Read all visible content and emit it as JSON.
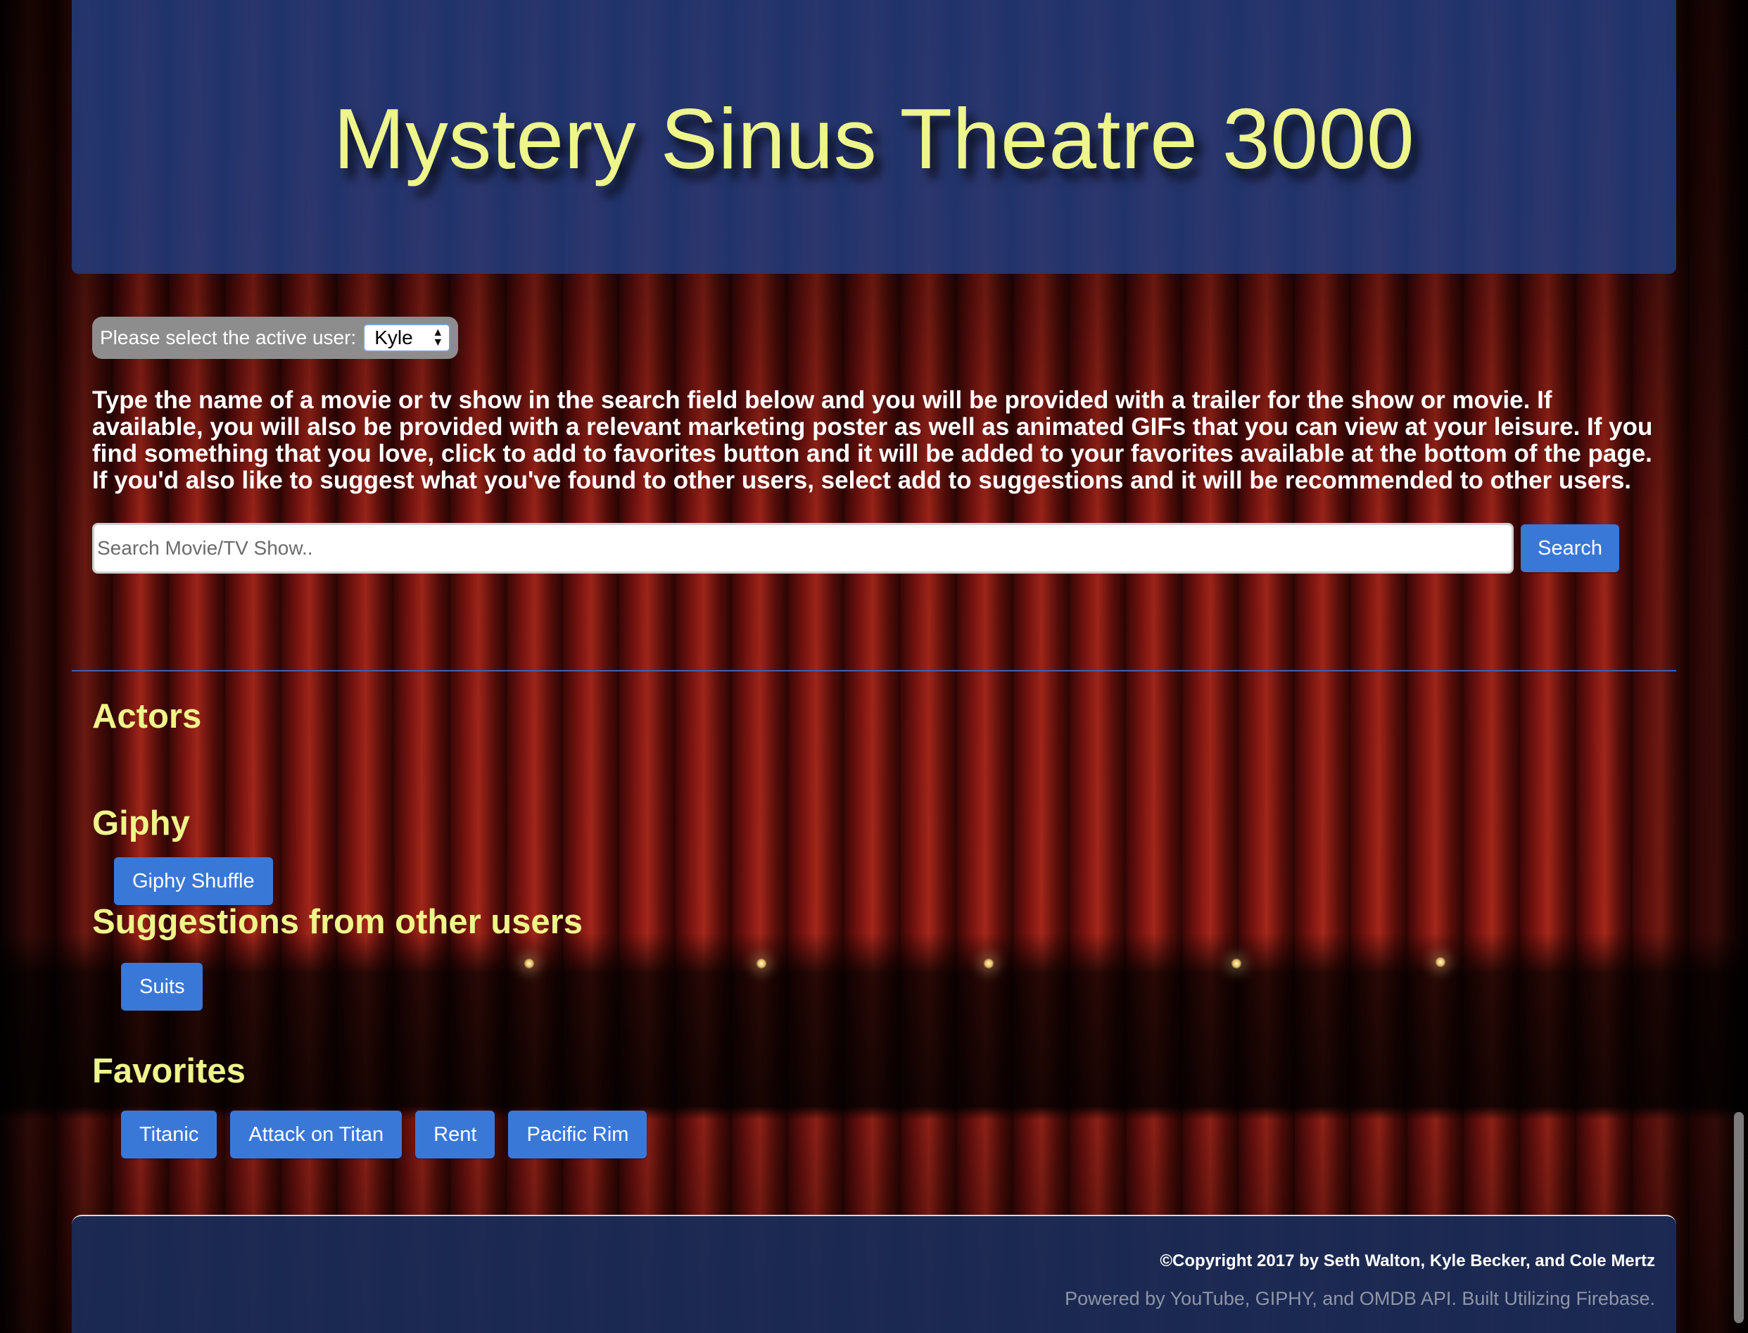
{
  "header": {
    "title": "Mystery Sinus Theatre 3000"
  },
  "user_select": {
    "label": "Please select the active user:",
    "selected": "Kyle"
  },
  "intro_text": "Type the name of a movie or tv show in the search field below and you will be provided with a trailer for the show or movie. If available, you will also be provided with a relevant marketing poster as well as animated GIFs that you can view at your leisure. If you find something that you love, click to add to favorites button and it will be added to your favorites available at the bottom of the page. If you'd also like to suggest what you've found to other users, select add to suggestions and it will be recommended to other users.",
  "search": {
    "placeholder": "Search Movie/TV Show..",
    "value": "",
    "button_label": "Search"
  },
  "sections": {
    "actors": {
      "title": "Actors"
    },
    "giphy": {
      "title": "Giphy",
      "button_label": "Giphy Shuffle"
    },
    "suggestions": {
      "title": "Suggestions from other users",
      "items": [
        "Suits"
      ]
    },
    "favorites": {
      "title": "Favorites",
      "items": [
        "Titanic",
        "Attack on Titan",
        "Rent",
        "Pacific Rim"
      ]
    }
  },
  "footer": {
    "copyright": "©Copyright 2017 by Seth Walton, Kyle Becker, and Cole Mertz",
    "powered_by": "Powered by YouTube, GIPHY, and OMDB API. Built Utilizing Firebase."
  },
  "colors": {
    "accent_yellow": "#eef58a",
    "button_blue": "#3a78d8",
    "header_blue": "#223e82"
  }
}
